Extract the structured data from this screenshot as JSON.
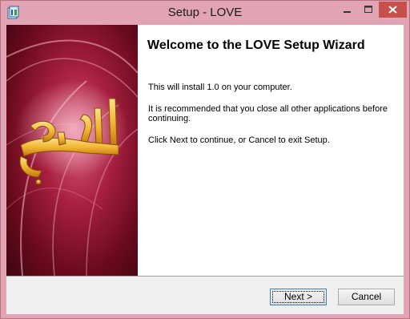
{
  "window": {
    "title": "Setup - LOVE",
    "app_icon": "setup-icon",
    "controls": {
      "minimize_icon": "minimize-icon",
      "maximize_icon": "maximize-icon",
      "close_icon": "close-icon",
      "close_color": "#c7504b"
    }
  },
  "banner": {
    "image_text": "الحب"
  },
  "wizard": {
    "heading": "Welcome to the LOVE Setup Wizard",
    "line1": "This will install 1.0 on your computer.",
    "line2": "It is recommended that you close all other applications before continuing.",
    "line3": "Click Next to continue, or Cancel to exit Setup."
  },
  "buttons": {
    "next": "Next >",
    "cancel": "Cancel"
  },
  "colors": {
    "frame": "#e0a4b4",
    "banner_dark": "#6a0a1d",
    "banner_light": "#d8617d",
    "lettering": "#f2b632"
  }
}
